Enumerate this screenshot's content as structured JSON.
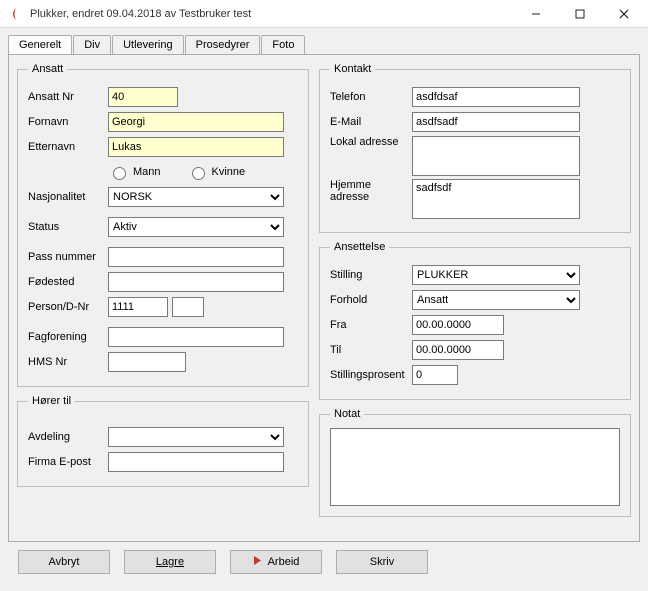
{
  "window": {
    "title": "Plukker, endret 09.04.2018 av Testbruker test"
  },
  "tabs": [
    "Generelt",
    "Div",
    "Utlevering",
    "Prosedyrer",
    "Foto"
  ],
  "ansatt": {
    "legend": "Ansatt",
    "ansattnr_label": "Ansatt Nr",
    "ansattnr": "40",
    "fornavn_label": "Fornavn",
    "fornavn": "Georgi",
    "etternavn_label": "Etternavn",
    "etternavn": "Lukas",
    "mann": "Mann",
    "kvinne": "Kvinne",
    "nasjonalitet_label": "Nasjonalitet",
    "nasjonalitet": "NORSK",
    "status_label": "Status",
    "status": "Aktiv",
    "passnummer_label": "Pass nummer",
    "passnummer": "",
    "fodested_label": "Fødested",
    "fodested": "",
    "persondnr_label": "Person/D-Nr",
    "persondnr": "1111",
    "persondnr2": "",
    "fagforening_label": "Fagforening",
    "fagforening": "",
    "hmsnr_label": "HMS Nr",
    "hmsnr": ""
  },
  "horertil": {
    "legend": "Hører til",
    "avdeling_label": "Avdeling",
    "avdeling": "",
    "firmaepost_label": "Firma E-post",
    "firmaepost": ""
  },
  "kontakt": {
    "legend": "Kontakt",
    "telefon_label": "Telefon",
    "telefon": "asdfdsaf",
    "email_label": "E-Mail",
    "email": "asdfsadf",
    "lokaladresse_label": "Lokal adresse",
    "lokaladresse": "",
    "hjemmeadresse_label": "Hjemme adresse",
    "hjemmeadresse": "sadfsdf"
  },
  "ansettelse": {
    "legend": "Ansettelse",
    "stilling_label": "Stilling",
    "stilling": "PLUKKER",
    "forhold_label": "Forhold",
    "forhold": "Ansatt",
    "fra_label": "Fra",
    "fra": "00.00.0000",
    "til_label": "Til",
    "til": "00.00.0000",
    "stillingprosent_label": "Stillingsprosent",
    "stillingprosent": "0"
  },
  "notat": {
    "legend": "Notat",
    "text": ""
  },
  "buttons": {
    "avbryt": "Avbryt",
    "lagre": "Lagre",
    "arbeid": "Arbeid",
    "skriv": "Skriv"
  }
}
